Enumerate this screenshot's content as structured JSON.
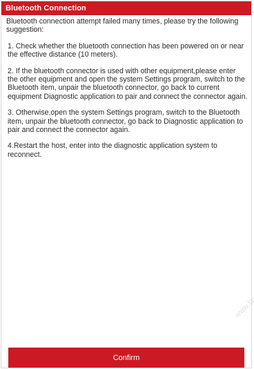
{
  "dialog": {
    "title": "Bluetooth Connection",
    "paragraphs": [
      "Bluetooth connection attempt failed many times, please try the following suggestion:",
      "1. Check whether the bluetooth connection has been powered on or near the effective distance (10 meters).",
      "2. If the bluetooth connector is used with other equipment,please enter the other equipment and open the system Settings program, switch to the Bluetooth item, unpair the bluetooth connector, go back to current equipment Diagnostic application to pair and connect the connector again.",
      "3. Otherwise,open the system Settings program, switch to the Bluetooth item, unpair the bluetooth connector, go back to Diagnostic application to pair and connect the connector again.",
      "4.Restart the host, enter into the diagnostic application system to reconnect."
    ],
    "confirm_label": "Confirm"
  },
  "watermark": "www.lau",
  "colors": {
    "accent": "#cc1a24",
    "text": "#2b2b2b"
  }
}
